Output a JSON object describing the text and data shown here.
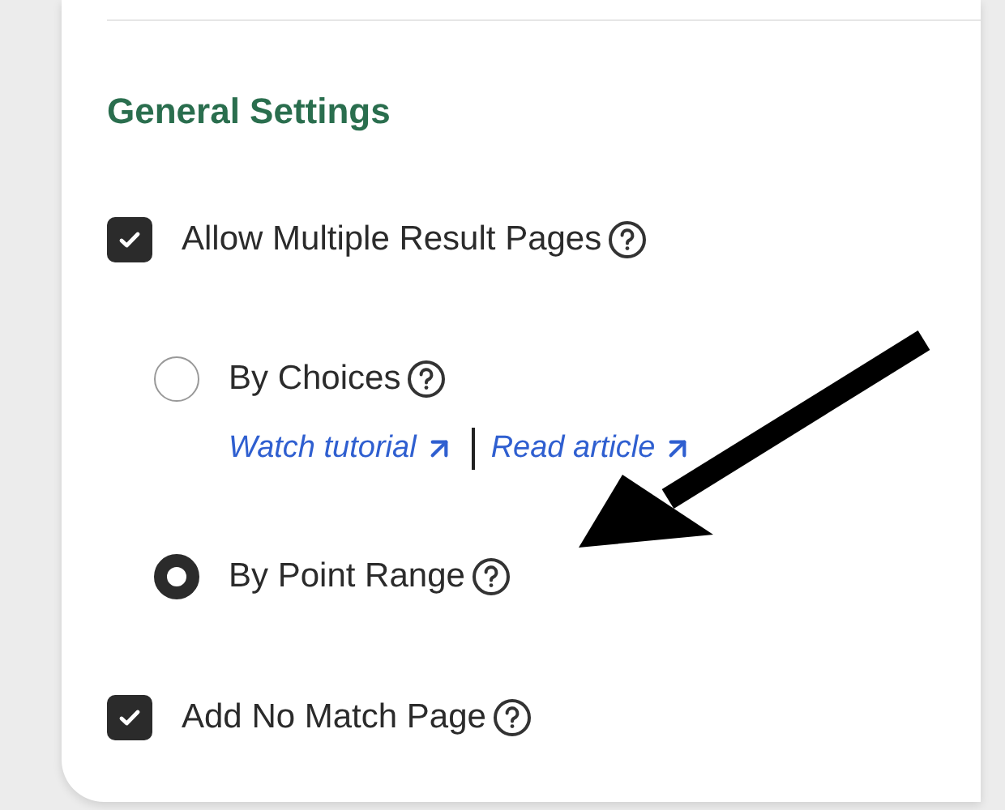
{
  "section": {
    "title": "General Settings"
  },
  "settings": [
    {
      "kind": "checkbox",
      "label": "Allow Multiple Result Pages",
      "checked": true,
      "children": [
        {
          "kind": "radio",
          "label": "By Choices",
          "selected": false,
          "links": [
            "Watch tutorial",
            "Read article"
          ]
        },
        {
          "kind": "radio",
          "label": "By Point Range",
          "selected": true
        }
      ]
    },
    {
      "kind": "checkbox",
      "label": "Add No Match Page",
      "checked": true
    }
  ]
}
